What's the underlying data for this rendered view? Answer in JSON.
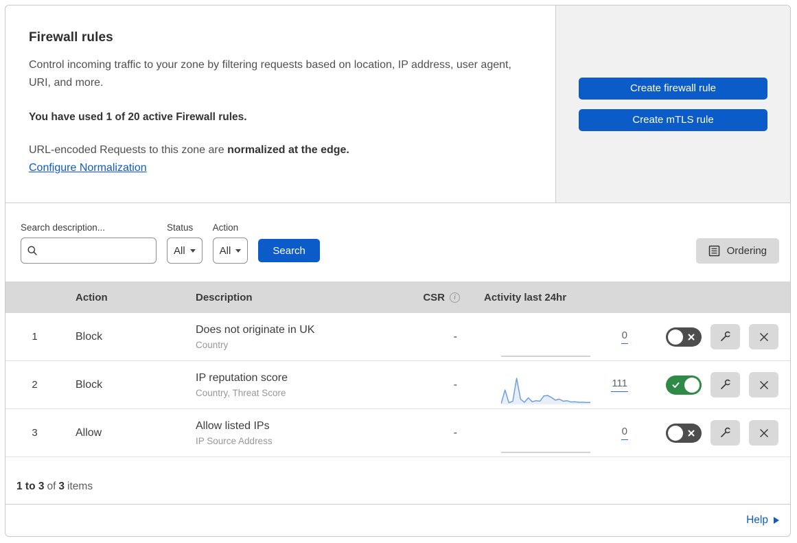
{
  "colors": {
    "accent_blue": "#0b5bc9",
    "link_blue": "#0b5bc9",
    "toggle_on_green": "#2e8a46",
    "toggle_off_gray": "#4d4d4d",
    "cta_panel_gray": "#f1f1f1",
    "table_header_gray": "#d9d9d9",
    "spark_line": "#6d9fe0",
    "spark_fill": "#e8eff9",
    "spark_flat": "#c4c4c4"
  },
  "banner": {
    "title": "Firewall rules",
    "description": "Control incoming traffic to your zone by filtering requests based on location, IP address, user agent, URI, and more.",
    "usage_note": "You have used 1 of 20 active Firewall rules.",
    "normalization_prefix": "URL-encoded Requests to this zone are ",
    "normalization_bold": "normalized at the edge.",
    "normalization_link": "Configure Normalization",
    "create_firewall_button": "Create firewall rule",
    "create_mtls_button": "Create mTLS rule"
  },
  "filters": {
    "search_label": "Search description...",
    "status_label": "Status",
    "status_value": "All",
    "action_label": "Action",
    "action_value": "All",
    "search_button": "Search",
    "ordering_button": "Ordering"
  },
  "table": {
    "headers": {
      "action": "Action",
      "description": "Description",
      "csr": "CSR",
      "activity": "Activity last 24hr"
    },
    "rows": [
      {
        "index": "1",
        "action": "Block",
        "description": "Does not originate in UK",
        "criteria": "Country",
        "csr": "-",
        "activity_count": "0",
        "enabled": false
      },
      {
        "index": "2",
        "action": "Block",
        "description": "IP reputation score",
        "criteria": "Country, Threat Score",
        "csr": "-",
        "activity_count": "111",
        "enabled": true
      },
      {
        "index": "3",
        "action": "Allow",
        "description": "Allow listed IPs",
        "criteria": "IP Source Address",
        "csr": "-",
        "activity_count": "0",
        "enabled": false
      }
    ]
  },
  "footer": {
    "range": "1 to 3",
    "of": "of",
    "total": "3",
    "items": "items",
    "help_label": "Help"
  },
  "chart_data": [
    {
      "type": "line",
      "title": "Rule 1 activity last 24hr",
      "flat": true,
      "values": [
        0,
        0,
        0,
        0,
        0,
        0,
        0,
        0,
        0,
        0,
        0,
        0,
        0,
        0,
        0,
        0,
        0,
        0,
        0,
        0,
        0,
        0,
        0,
        0
      ],
      "ylim": [
        0,
        1
      ]
    },
    {
      "type": "line",
      "title": "Rule 2 activity last 24hr (total 111 requests)",
      "flat": false,
      "values": [
        3,
        55,
        6,
        12,
        100,
        20,
        8,
        25,
        10,
        14,
        12,
        32,
        34,
        26,
        16,
        20,
        12,
        14,
        9,
        10,
        8,
        8,
        7,
        7
      ],
      "ylim": [
        0,
        100
      ],
      "color": "#6d9fe0",
      "fill": "#e8eff9"
    },
    {
      "type": "line",
      "title": "Rule 3 activity last 24hr",
      "flat": true,
      "values": [
        0,
        0,
        0,
        0,
        0,
        0,
        0,
        0,
        0,
        0,
        0,
        0,
        0,
        0,
        0,
        0,
        0,
        0,
        0,
        0,
        0,
        0,
        0,
        0
      ],
      "ylim": [
        0,
        1
      ]
    }
  ]
}
